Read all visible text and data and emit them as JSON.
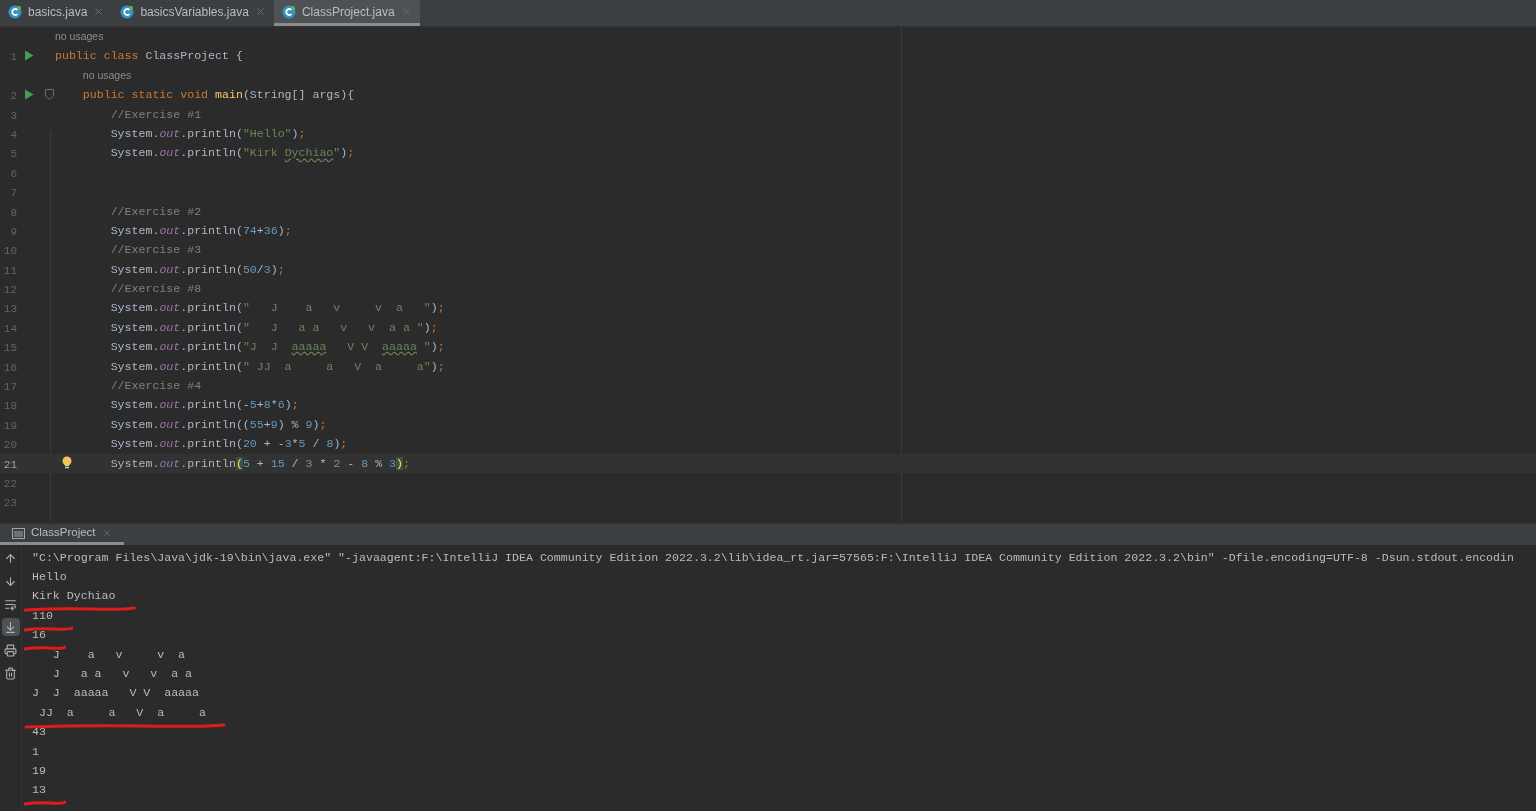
{
  "tabs": [
    {
      "label": "basics.java",
      "selected": false
    },
    {
      "label": "basicsVariables.java",
      "selected": false
    },
    {
      "label": "ClassProject.java",
      "selected": true
    }
  ],
  "editor": {
    "lines": [
      {
        "n": "1",
        "hint": "no usages",
        "run": true,
        "fold": false,
        "bulb": false,
        "current": false,
        "tokens": [
          {
            "kind": "kw",
            "text": "public class "
          },
          {
            "kind": "plain",
            "text": "ClassProject {"
          }
        ]
      },
      {
        "n": "2",
        "hint": "no usages",
        "run": true,
        "fold": true,
        "bulb": false,
        "current": false,
        "tokens": [
          {
            "kind": "kw",
            "text": "    public static void "
          },
          {
            "kind": "method",
            "text": "main"
          },
          {
            "kind": "plain",
            "text": "(String[] args){"
          }
        ]
      },
      {
        "n": "3",
        "run": false,
        "fold": false,
        "bulb": false,
        "current": false,
        "tokens": [
          {
            "kind": "comment",
            "text": "        //Exercise #1"
          }
        ]
      },
      {
        "n": "4",
        "run": false,
        "fold": false,
        "bulb": false,
        "current": false,
        "tokens": [
          {
            "kind": "plain",
            "text": "        System."
          },
          {
            "kind": "field",
            "text": "out"
          },
          {
            "kind": "plain",
            "text": ".println("
          },
          {
            "kind": "str",
            "text": "\"Hello\""
          },
          {
            "kind": "plain",
            "text": ")"
          },
          {
            "kind": "semi",
            "text": ";"
          }
        ]
      },
      {
        "n": "5",
        "run": false,
        "fold": false,
        "bulb": false,
        "current": false,
        "tokens": [
          {
            "kind": "plain",
            "text": "        System."
          },
          {
            "kind": "field",
            "text": "out"
          },
          {
            "kind": "plain",
            "text": ".println("
          },
          {
            "kind": "str",
            "text": "\"Kirk "
          },
          {
            "kind": "typo",
            "text": "Dychiao"
          },
          {
            "kind": "str",
            "text": "\""
          },
          {
            "kind": "plain",
            "text": ")"
          },
          {
            "kind": "semi",
            "text": ";"
          }
        ]
      },
      {
        "n": "6",
        "run": false,
        "fold": false,
        "bulb": false,
        "current": false
      },
      {
        "n": "7",
        "run": false,
        "fold": false,
        "bulb": false,
        "current": false
      },
      {
        "n": "8",
        "run": false,
        "fold": false,
        "bulb": false,
        "current": false,
        "tokens": [
          {
            "kind": "comment",
            "text": "        //Exercise #2"
          }
        ]
      },
      {
        "n": "9",
        "run": false,
        "fold": false,
        "bulb": false,
        "current": false,
        "tokens": [
          {
            "kind": "plain",
            "text": "        System."
          },
          {
            "kind": "field",
            "text": "out"
          },
          {
            "kind": "plain",
            "text": ".println("
          },
          {
            "kind": "num",
            "text": "74"
          },
          {
            "kind": "plain",
            "text": "+"
          },
          {
            "kind": "num",
            "text": "36"
          },
          {
            "kind": "plain",
            "text": ")"
          },
          {
            "kind": "semi",
            "text": ";"
          }
        ]
      },
      {
        "n": "10",
        "run": false,
        "fold": false,
        "bulb": false,
        "current": false,
        "tokens": [
          {
            "kind": "comment",
            "text": "        //Exercise #3"
          }
        ]
      },
      {
        "n": "11",
        "run": false,
        "fold": false,
        "bulb": false,
        "current": false,
        "tokens": [
          {
            "kind": "plain",
            "text": "        System."
          },
          {
            "kind": "field",
            "text": "out"
          },
          {
            "kind": "plain",
            "text": ".println("
          },
          {
            "kind": "num",
            "text": "50"
          },
          {
            "kind": "plain",
            "text": "/"
          },
          {
            "kind": "num",
            "text": "3"
          },
          {
            "kind": "plain",
            "text": ")"
          },
          {
            "kind": "semi",
            "text": ";"
          }
        ]
      },
      {
        "n": "12",
        "run": false,
        "fold": false,
        "bulb": false,
        "current": false,
        "tokens": [
          {
            "kind": "comment",
            "text": "        //Exercise #8"
          }
        ]
      },
      {
        "n": "13",
        "run": false,
        "fold": false,
        "bulb": false,
        "current": false,
        "tokens": [
          {
            "kind": "plain",
            "text": "        System."
          },
          {
            "kind": "field",
            "text": "out"
          },
          {
            "kind": "plain",
            "text": ".println("
          },
          {
            "kind": "str",
            "text": "\"   J    a   v     v  a   \""
          },
          {
            "kind": "plain",
            "text": ")"
          },
          {
            "kind": "semi",
            "text": ";"
          }
        ]
      },
      {
        "n": "14",
        "run": false,
        "fold": false,
        "bulb": false,
        "current": false,
        "tokens": [
          {
            "kind": "plain",
            "text": "        System."
          },
          {
            "kind": "field",
            "text": "out"
          },
          {
            "kind": "plain",
            "text": ".println("
          },
          {
            "kind": "str",
            "text": "\"   J   a a   v   v  a a \""
          },
          {
            "kind": "plain",
            "text": ")"
          },
          {
            "kind": "semi",
            "text": ";"
          }
        ]
      },
      {
        "n": "15",
        "run": false,
        "fold": false,
        "bulb": false,
        "current": false,
        "tokens": [
          {
            "kind": "plain",
            "text": "        System."
          },
          {
            "kind": "field",
            "text": "out"
          },
          {
            "kind": "plain",
            "text": ".println("
          },
          {
            "kind": "str",
            "text": "\"J  J  "
          },
          {
            "kind": "typo",
            "text": "aaaaa"
          },
          {
            "kind": "str",
            "text": "   V V  "
          },
          {
            "kind": "typo",
            "text": "aaaaa"
          },
          {
            "kind": "str",
            "text": " \""
          },
          {
            "kind": "plain",
            "text": ")"
          },
          {
            "kind": "semi",
            "text": ";"
          }
        ]
      },
      {
        "n": "16",
        "run": false,
        "fold": false,
        "bulb": false,
        "current": false,
        "tokens": [
          {
            "kind": "plain",
            "text": "        System."
          },
          {
            "kind": "field",
            "text": "out"
          },
          {
            "kind": "plain",
            "text": ".println("
          },
          {
            "kind": "str",
            "text": "\" JJ  a     a   V  a     a\""
          },
          {
            "kind": "plain",
            "text": ")"
          },
          {
            "kind": "semi",
            "text": ";"
          }
        ]
      },
      {
        "n": "17",
        "run": false,
        "fold": false,
        "bulb": false,
        "current": false,
        "tokens": [
          {
            "kind": "comment",
            "text": "        //Exercise #4"
          }
        ]
      },
      {
        "n": "18",
        "run": false,
        "fold": false,
        "bulb": false,
        "current": false,
        "tokens": [
          {
            "kind": "plain",
            "text": "        System."
          },
          {
            "kind": "field",
            "text": "out"
          },
          {
            "kind": "plain",
            "text": ".println(-"
          },
          {
            "kind": "num",
            "text": "5"
          },
          {
            "kind": "plain",
            "text": "+"
          },
          {
            "kind": "num",
            "text": "8"
          },
          {
            "kind": "plain",
            "text": "*"
          },
          {
            "kind": "num",
            "text": "6"
          },
          {
            "kind": "plain",
            "text": ")"
          },
          {
            "kind": "semi",
            "text": ";"
          }
        ]
      },
      {
        "n": "19",
        "run": false,
        "fold": false,
        "bulb": false,
        "current": false,
        "tokens": [
          {
            "kind": "plain",
            "text": "        System."
          },
          {
            "kind": "field",
            "text": "out"
          },
          {
            "kind": "plain",
            "text": ".println(("
          },
          {
            "kind": "num",
            "text": "55"
          },
          {
            "kind": "plain",
            "text": "+"
          },
          {
            "kind": "num",
            "text": "9"
          },
          {
            "kind": "plain",
            "text": ") % "
          },
          {
            "kind": "num",
            "text": "9"
          },
          {
            "kind": "plain",
            "text": ")"
          },
          {
            "kind": "semi",
            "text": ";"
          }
        ]
      },
      {
        "n": "20",
        "run": false,
        "fold": false,
        "bulb": false,
        "current": false,
        "tokens": [
          {
            "kind": "plain",
            "text": "        System."
          },
          {
            "kind": "field",
            "text": "out"
          },
          {
            "kind": "plain",
            "text": ".println("
          },
          {
            "kind": "num",
            "text": "20"
          },
          {
            "kind": "plain",
            "text": " + -"
          },
          {
            "kind": "num",
            "text": "3"
          },
          {
            "kind": "plain",
            "text": "*"
          },
          {
            "kind": "num",
            "text": "5"
          },
          {
            "kind": "plain",
            "text": " / "
          },
          {
            "kind": "num",
            "text": "8"
          },
          {
            "kind": "plain",
            "text": ")"
          },
          {
            "kind": "semi",
            "text": ";"
          }
        ]
      },
      {
        "n": "21",
        "run": false,
        "fold": false,
        "bulb": true,
        "current": true,
        "tokens": [
          {
            "kind": "plain",
            "text": "        System."
          },
          {
            "kind": "field",
            "text": "out"
          },
          {
            "kind": "plain",
            "text": ".println"
          },
          {
            "kind": "paren",
            "text": "("
          },
          {
            "kind": "num",
            "text": "5"
          },
          {
            "kind": "plain",
            "text": " + "
          },
          {
            "kind": "num",
            "text": "15"
          },
          {
            "kind": "plain",
            "text": " / "
          },
          {
            "kind": "num",
            "text": "3"
          },
          {
            "kind": "plain",
            "text": " * "
          },
          {
            "kind": "num",
            "text": "2"
          },
          {
            "kind": "plain",
            "text": " - "
          },
          {
            "kind": "num",
            "text": "8"
          },
          {
            "kind": "plain",
            "text": " % "
          },
          {
            "kind": "num",
            "text": "3"
          },
          {
            "kind": "paren",
            "text": ")"
          },
          {
            "kind": "semi",
            "text": ";"
          }
        ]
      },
      {
        "n": "22",
        "run": false,
        "fold": false,
        "bulb": false,
        "current": false
      },
      {
        "n": "23",
        "run": false,
        "fold": false,
        "bulb": false,
        "current": false
      }
    ]
  },
  "console": {
    "tab": {
      "label": "ClassProject",
      "selected": true
    },
    "toolbar": [
      {
        "kind": "up",
        "on": false
      },
      {
        "kind": "down",
        "on": false
      },
      {
        "kind": "wrap",
        "on": false
      },
      {
        "kind": "scroll",
        "on": true
      },
      {
        "kind": "print",
        "on": false
      },
      {
        "kind": "clear",
        "on": false
      }
    ],
    "lines": [
      {
        "text": "\"C:\\Program Files\\Java\\jdk-19\\bin\\java.exe\" \"-javaagent:F:\\IntelliJ IDEA Community Edition 2022.3.2\\lib\\idea_rt.jar=57565:F:\\IntelliJ IDEA Community Edition 2022.3.2\\bin\" -Dfile.encoding=UTF-8 -Dsun.stdout.encodin",
        "marked": false
      },
      {
        "text": "Hello",
        "marked": false
      },
      {
        "text": "Kirk Dychiao",
        "marked": true
      },
      {
        "text": "110",
        "marked": true
      },
      {
        "text": "16",
        "marked": true
      },
      {
        "text": "   J    a   v     v  a",
        "marked": false
      },
      {
        "text": "   J   a a   v   v  a a",
        "marked": false
      },
      {
        "text": "J  J  aaaaa   V V  aaaaa",
        "marked": false
      },
      {
        "text": " JJ  a     a   V  a     a",
        "marked": true
      },
      {
        "text": "43",
        "marked": false
      },
      {
        "text": "1",
        "marked": false
      },
      {
        "text": "19",
        "marked": false
      },
      {
        "text": "13",
        "marked": true
      }
    ]
  }
}
